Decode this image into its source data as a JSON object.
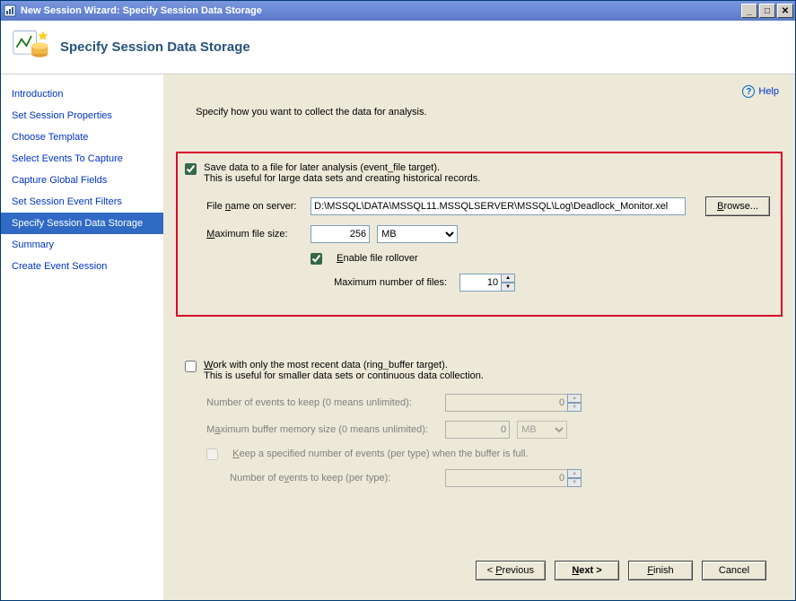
{
  "window": {
    "title": "New Session Wizard: Specify Session Data Storage"
  },
  "header": {
    "title": "Specify Session Data Storage"
  },
  "sidebar": {
    "items": [
      {
        "label": "Introduction"
      },
      {
        "label": "Set Session Properties"
      },
      {
        "label": "Choose Template"
      },
      {
        "label": "Select Events To Capture"
      },
      {
        "label": "Capture Global Fields"
      },
      {
        "label": "Set Session Event Filters"
      },
      {
        "label": "Specify Session Data Storage"
      },
      {
        "label": "Summary"
      },
      {
        "label": "Create Event Session"
      }
    ],
    "activeIndex": 6
  },
  "help": {
    "label": "Help"
  },
  "main": {
    "instruction": "Specify how you want to collect the data for analysis.",
    "fileTarget": {
      "checked": true,
      "label": "Save data to a file for later analysis (event_file target).",
      "sub": "This is useful for large data sets and creating historical records.",
      "fileLabel": "File name on server:",
      "fileValue": "D:\\MSSQL\\DATA\\MSSQL11.MSSQLSERVER\\MSSQL\\Log\\Deadlock_Monitor.xel",
      "browse": "Browse...",
      "maxSizeLabel": "Maximum file size:",
      "maxSizeValue": "256",
      "maxSizeUnit": "MB",
      "rolloverChecked": true,
      "rolloverLabel": "Enable file rollover",
      "maxFilesLabel": "Maximum number of files:",
      "maxFilesValue": "10"
    },
    "ringTarget": {
      "checked": false,
      "label": "Work with only the most recent data (ring_buffer target).",
      "sub": "This is useful for smaller data sets or continuous data collection.",
      "numEventsLabel": "Number of events to keep (0 means unlimited):",
      "numEventsValue": "0",
      "maxMemLabel": "Maximum buffer memory size (0 means unlimited):",
      "maxMemValue": "0",
      "maxMemUnit": "MB",
      "keepPerTypeChecked": false,
      "keepPerTypeLabel": "Keep a specified number of events (per type) when the buffer is full.",
      "numPerTypeLabel": "Number of events to keep (per type):",
      "numPerTypeValue": "0"
    }
  },
  "footer": {
    "previous": "< Previous",
    "next": "Next >",
    "finish": "Finish",
    "cancel": "Cancel"
  }
}
